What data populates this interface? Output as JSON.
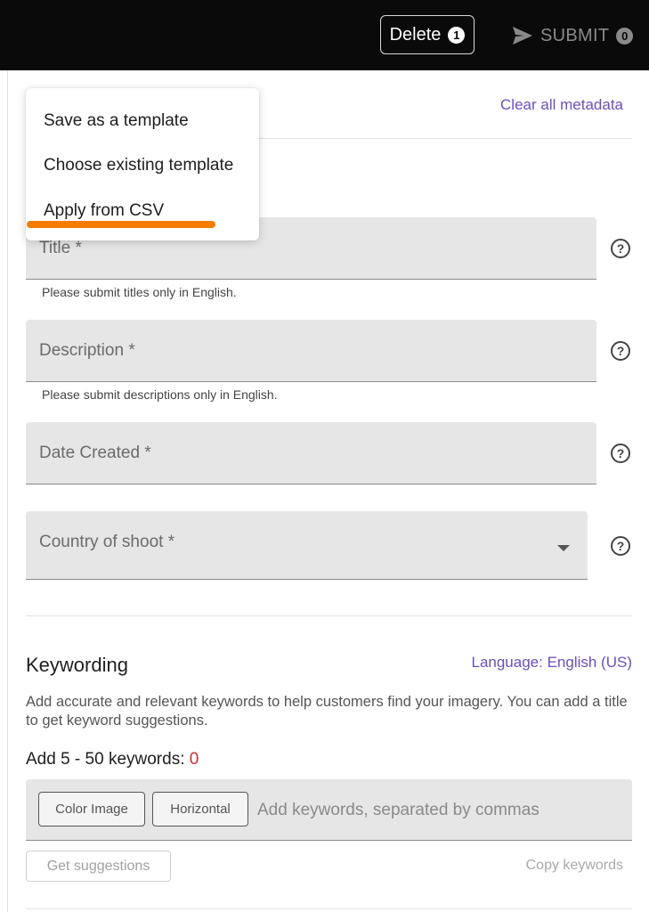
{
  "topbar": {
    "delete_label": "Delete",
    "delete_count": "1",
    "submit_label": "SUBMIT",
    "submit_count": "0"
  },
  "header": {
    "clear_all": "Clear all metadata"
  },
  "menu": {
    "items": [
      "Save as a template",
      "Choose existing template",
      "Apply from CSV"
    ],
    "highlight_color": "#f57c00"
  },
  "form": {
    "title": {
      "label": "Title *",
      "hint": "Please submit titles only in English."
    },
    "description": {
      "label": "Description *",
      "hint": "Please submit descriptions only in English."
    },
    "date_created": {
      "label": "Date Created *"
    },
    "country": {
      "label": "Country of shoot *"
    },
    "help_glyph": "?"
  },
  "keywording": {
    "title": "Keywording",
    "language": "Language: English (US)",
    "description": "Add accurate and relevant keywords to help customers find your imagery. You can add a title to get keyword suggestions.",
    "count_prefix": "Add 5 - 50 keywords: ",
    "count_value": "0",
    "chips": [
      "Color Image",
      "Horizontal"
    ],
    "placeholder": "Add keywords, separated by commas",
    "get_suggestions": "Get suggestions",
    "copy_keywords": "Copy keywords"
  },
  "colors": {
    "accent": "#6c4fbf",
    "error": "#d32f2f"
  }
}
